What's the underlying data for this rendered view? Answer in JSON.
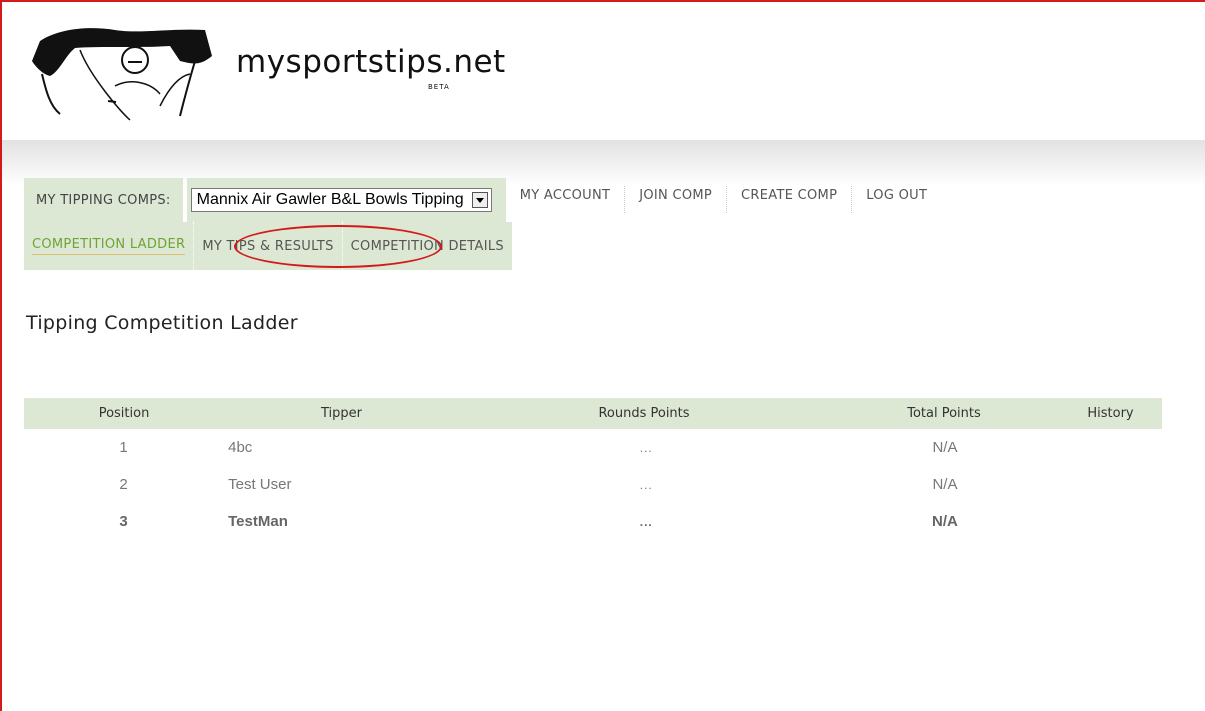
{
  "site": {
    "logo_text": "mysportstips.net",
    "logo_badge": "BETA"
  },
  "nav": {
    "comps_label": "MY TIPPING COMPS:",
    "selected_comp": "Mannix Air Gawler B&L Bowls Tipping",
    "links": [
      "MY ACCOUNT",
      "JOIN COMP",
      "CREATE COMP",
      "LOG OUT"
    ]
  },
  "subnav": {
    "items": [
      "COMPETITION LADDER",
      "MY TIPS & RESULTS",
      "COMPETITION DETAILS"
    ],
    "active_index": 0
  },
  "page": {
    "title": "Tipping Competition Ladder"
  },
  "ladder": {
    "columns": [
      "Position",
      "Tipper",
      "Rounds Points",
      "Total Points",
      "History"
    ],
    "rows": [
      {
        "position": "1",
        "tipper": "4bc",
        "rounds": "...",
        "total": "N/A",
        "history": ""
      },
      {
        "position": "2",
        "tipper": "Test User",
        "rounds": "...",
        "total": "N/A",
        "history": ""
      },
      {
        "position": "3",
        "tipper": "TestMan",
        "rounds": "...",
        "total": "N/A",
        "history": ""
      }
    ]
  },
  "colors": {
    "accent_green": "#6fa334",
    "nav_bg": "#dde8d4",
    "annotation_red": "#d21a1a"
  }
}
